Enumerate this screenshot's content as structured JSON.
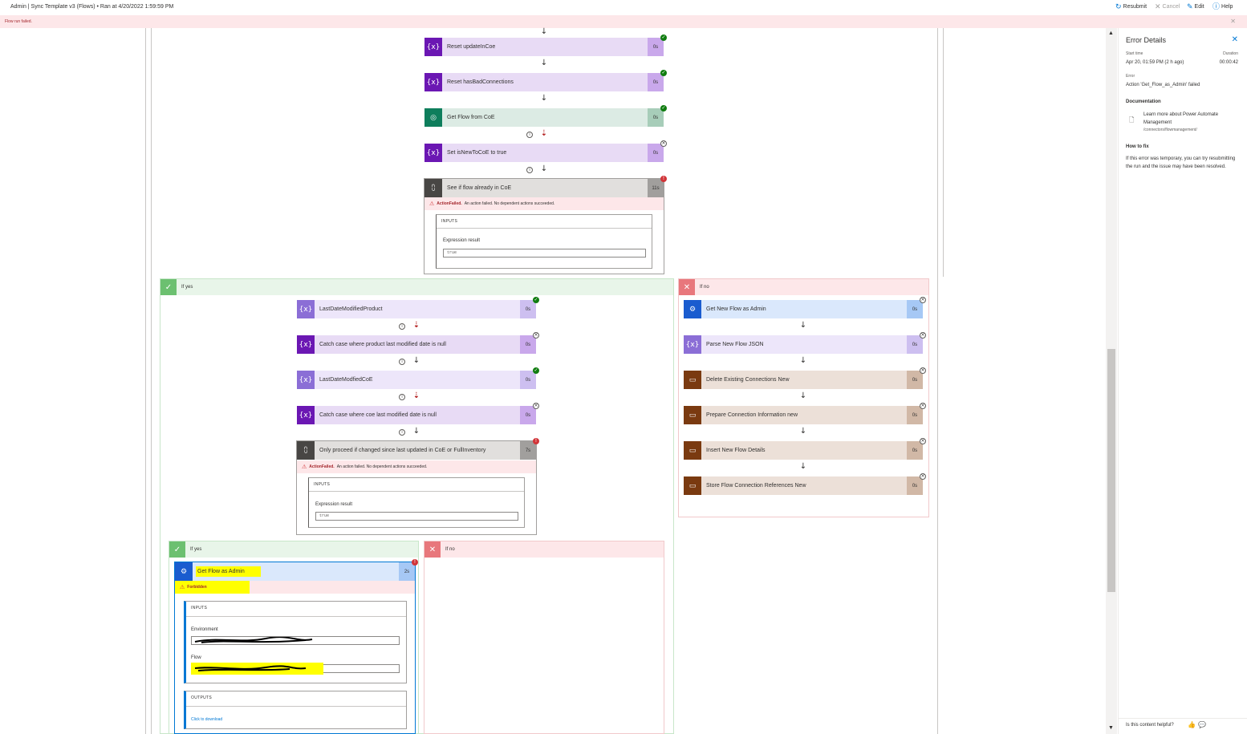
{
  "topbar": {
    "title": "Admin | Sync Template v3 (Flows) • Ran at 4/20/2022 1:59:59 PM",
    "resubmit": "Resubmit",
    "cancel": "Cancel",
    "edit": "Edit",
    "help": "Help"
  },
  "error_banner": "Flow run failed.",
  "main_flow": {
    "steps": [
      {
        "label": "Reset updateInCoe",
        "duration": "0s",
        "status": "succeeded"
      },
      {
        "label": "Reset hasBadConnections",
        "duration": "0s",
        "status": "succeeded"
      },
      {
        "label": "Get Flow from CoE",
        "duration": "0s",
        "status": "succeeded"
      },
      {
        "label": "Set isNewToCoE to true",
        "duration": "0s",
        "status": "skipped"
      },
      {
        "label": "See if flow already in CoE",
        "duration": "11s",
        "status": "failed"
      }
    ],
    "condition_error": {
      "code": "ActionFailed.",
      "message": "An action failed. No dependent actions succeeded."
    },
    "inputs_header": "INPUTS",
    "expr_label": "Expression result",
    "expr_value": "true"
  },
  "if_yes_branch": {
    "label": "If yes",
    "steps": [
      {
        "label": "LastDateModifiedProduct",
        "duration": "0s",
        "status": "succeeded"
      },
      {
        "label": "Catch case where product last modified date is null",
        "duration": "0s",
        "status": "skipped"
      },
      {
        "label": "LastDateModfiedCoE",
        "duration": "0s",
        "status": "succeeded"
      },
      {
        "label": "Catch case where coe last modified date is null",
        "duration": "0s",
        "status": "skipped"
      },
      {
        "label": "Only proceed if changed since last updated in CoE or FullInventory",
        "duration": "7s",
        "status": "failed"
      }
    ],
    "condition_error": {
      "code": "ActionFailed.",
      "message": "An action failed. No dependent actions succeeded."
    },
    "inputs_header": "INPUTS",
    "expr_label": "Expression result",
    "expr_value": "true"
  },
  "if_no_branch": {
    "label": "If no",
    "steps": [
      {
        "label": "Get New Flow as Admin",
        "duration": "0s",
        "status": "skipped"
      },
      {
        "label": "Parse New Flow JSON",
        "duration": "0s",
        "status": "skipped"
      },
      {
        "label": "Delete Existing Connections New",
        "duration": "0s",
        "status": "skipped"
      },
      {
        "label": "Prepare Connection Information new",
        "duration": "0s",
        "status": "skipped"
      },
      {
        "label": "Insert New Flow Details",
        "duration": "0s",
        "status": "skipped"
      },
      {
        "label": "Store Flow Connection References New",
        "duration": "0s",
        "status": "skipped"
      }
    ]
  },
  "nested_yes": {
    "label": "If yes",
    "step": {
      "label": "Get Flow as Admin",
      "duration": "2s",
      "status": "failed"
    },
    "error": "Forbidden",
    "inputs_header": "INPUTS",
    "env_label": "Environment",
    "flow_label": "Flow",
    "outputs_header": "OUTPUTS",
    "download": "Click to download"
  },
  "nested_no": {
    "label": "If no"
  },
  "panel": {
    "title": "Error Details",
    "start_time_label": "Start time",
    "start_time": "Apr 20, 01:59 PM (2 h ago)",
    "duration_label": "Duration",
    "duration": "00:00:42",
    "error_label": "Error",
    "error_text": "Action 'Get_Flow_as_Admin' failed",
    "doc_header": "Documentation",
    "doc_link": "Learn more about Power Automate Management",
    "doc_path": "/connectors/flowmanagement/",
    "howto_header": "How to fix",
    "howto_text": "If this error was temporary, you can try resubmitting the run and the issue may have been resolved.",
    "feedback": "Is this content helpful?"
  },
  "colors": {
    "variable_purple": "#6b17b3",
    "variable_bg": "#e8dbf5",
    "condition_gray": "#484644",
    "dataverse_green": "#0e7e5c",
    "admin_blue": "#1a5ccf",
    "sql_brown": "#7a3a10"
  }
}
